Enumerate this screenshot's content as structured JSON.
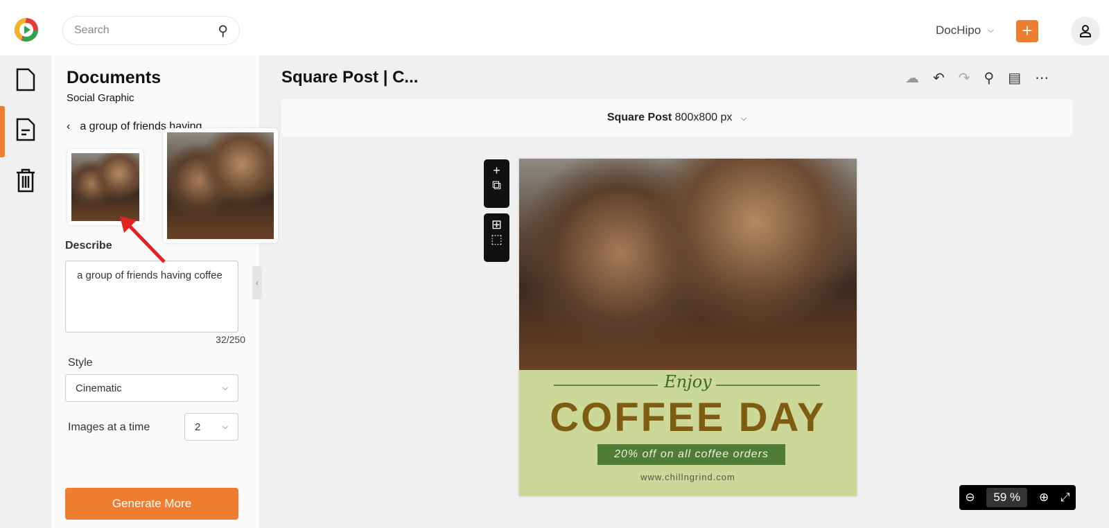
{
  "header": {
    "search_placeholder": "Search",
    "workspace": "DocHipo",
    "add_label": "+"
  },
  "panel": {
    "title": "Documents",
    "subtitle": "Social Graphic",
    "back_label": "a group of friends having",
    "describe_label": "Describe",
    "describe_value": "a group of friends having coffee",
    "char_count": "32/250",
    "style_label": "Style",
    "style_value": "Cinematic",
    "images_label": "Images at a time",
    "images_value": "2",
    "generate_label": "Generate More"
  },
  "editor": {
    "title": "Square Post | C...",
    "size_name": "Square Post",
    "size_dims": "800x800 px",
    "zoom": "59",
    "zoom_unit": "%"
  },
  "design": {
    "enjoy": "Enjoy",
    "headline": "COFFEE DAY",
    "offer": "20% off on all coffee orders",
    "website": "www.chillngrind.com"
  },
  "colors": {
    "accent": "#ee7d30",
    "design_bg": "#cbd898",
    "headline": "#7e5c12",
    "offer_bg": "#4f7d36"
  }
}
